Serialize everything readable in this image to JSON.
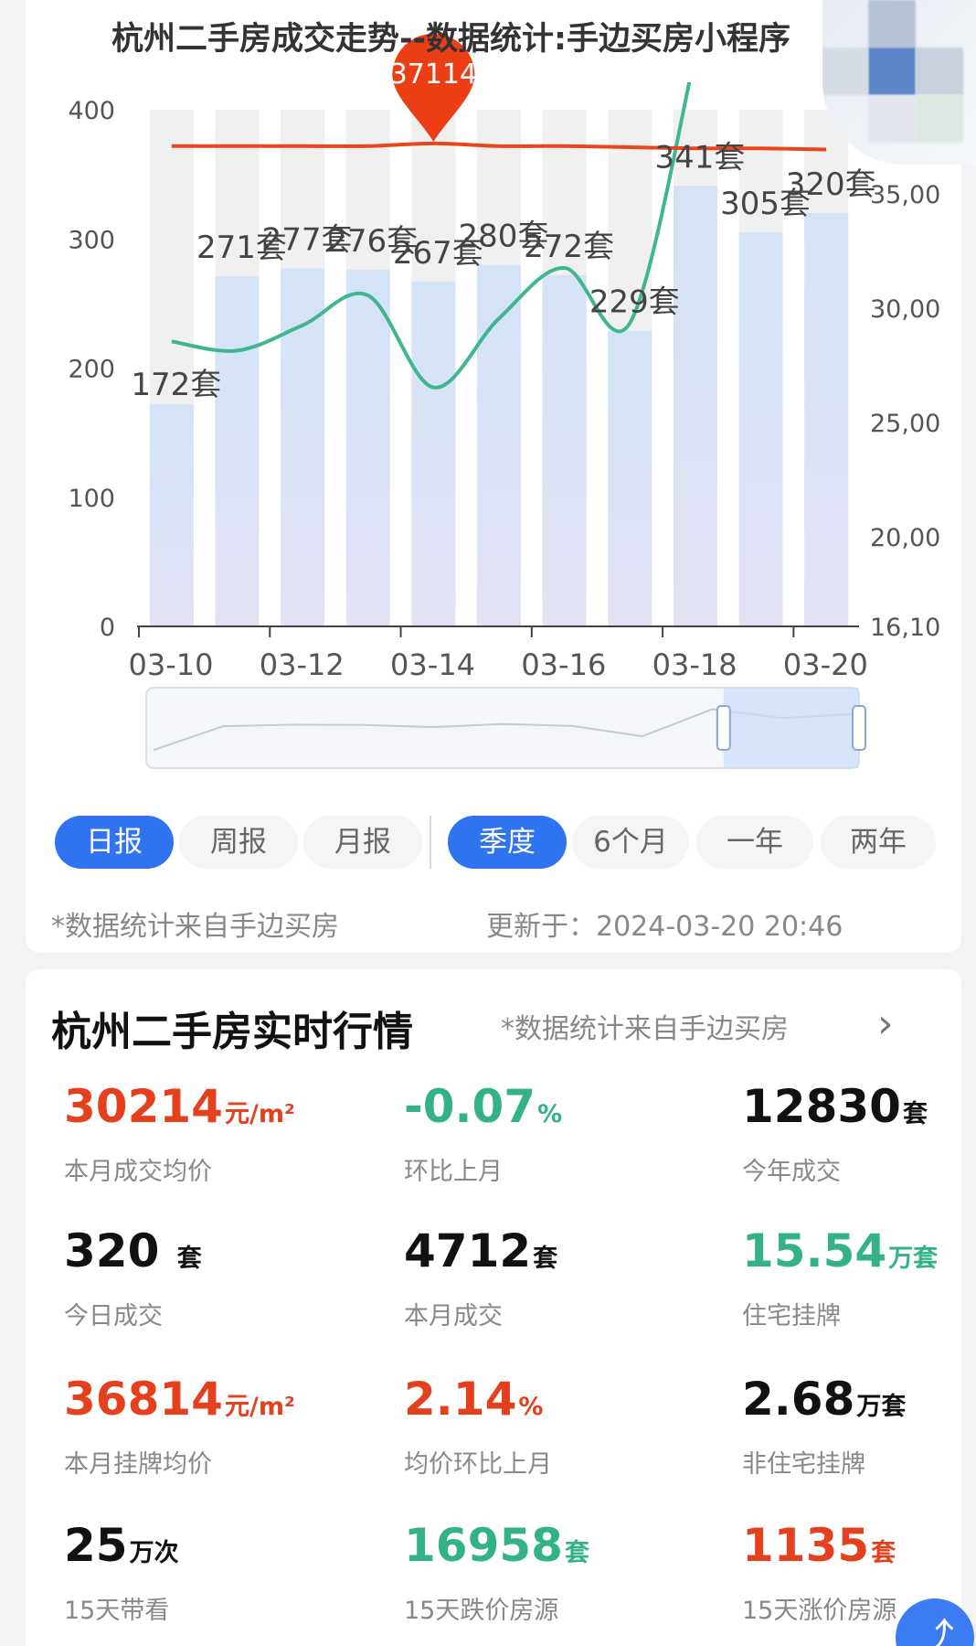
{
  "chart_title": "杭州二手房成交走势--数据统计:手边买房小程序",
  "chart_data": {
    "type": "bar+line",
    "title": "杭州二手房成交走势--数据统计:手边买房小程序",
    "categories": [
      "03-10",
      "03-11",
      "03-12",
      "03-13",
      "03-14",
      "03-15",
      "03-16",
      "03-17",
      "03-18",
      "03-19",
      "03-20"
    ],
    "x_tick_labels": [
      "03-10",
      "03-12",
      "03-14",
      "03-16",
      "03-18",
      "03-20"
    ],
    "bars": {
      "values": [
        172,
        271,
        277,
        276,
        267,
        280,
        272,
        229,
        341,
        305,
        320
      ],
      "labels": [
        "172套",
        "271套",
        "277套",
        "276套",
        "267套",
        "280套",
        "272套",
        "229套",
        "341套",
        "305套",
        "320套"
      ]
    },
    "y_left": {
      "ticks": [
        "400",
        "300",
        "200",
        "100",
        "0"
      ],
      "ylim": [
        0,
        400
      ]
    },
    "y_right": {
      "ticks": [
        "35,00",
        "30,00",
        "25,00",
        "20,00",
        "16,10"
      ],
      "ylim": [
        16100,
        35000
      ]
    },
    "green_line": {
      "values": [
        28500,
        28100,
        29200,
        30500,
        26500,
        29500,
        31700,
        29300,
        41000,
        41000,
        41000
      ]
    },
    "red_line": {
      "values": [
        37000,
        37000,
        37000,
        37000,
        37114,
        37000,
        37000,
        36950,
        36900,
        36900,
        36850
      ]
    },
    "marker": {
      "label": "37114",
      "category": "03-14"
    },
    "zoom_window": {
      "start_fraction": 0.81,
      "end_fraction": 1.0
    },
    "colors": {
      "bar": "#d7e3f5",
      "bar_bg": "#f0f0f0",
      "green": "#3fb68e",
      "red": "#e8471b",
      "marker": "#ec3e14",
      "text": "#444444"
    }
  },
  "tabs": [
    {
      "label": "日报",
      "active": true
    },
    {
      "label": "周报",
      "active": false
    },
    {
      "label": "月报",
      "active": false
    },
    {
      "label": "季度",
      "active": true
    },
    {
      "label": "6个月",
      "active": false
    },
    {
      "label": "一年",
      "active": false
    },
    {
      "label": "两年",
      "active": false
    }
  ],
  "footnote_source": "*数据统计来自手边买房",
  "footnote_updated": "更新于：2024-03-20 20:46",
  "market": {
    "title": "杭州二手房实时行情",
    "subtitle": "*数据统计来自手边买房",
    "arrow": "›",
    "metrics": [
      {
        "value": "30214",
        "unit": "元/m²",
        "label": "本月成交均价",
        "color": "red"
      },
      {
        "value": "-0.07",
        "unit": "%",
        "label": "环比上月",
        "color": "green"
      },
      {
        "value": "12830",
        "unit": "套",
        "label": "今年成交",
        "color": "black"
      },
      {
        "value": "320 ",
        "unit": "套",
        "label": "今日成交",
        "color": "black"
      },
      {
        "value": "4712",
        "unit": "套",
        "label": "本月成交",
        "color": "black"
      },
      {
        "value": "15.54",
        "unit": "万套",
        "label": "住宅挂牌",
        "color": "green"
      },
      {
        "value": "36814",
        "unit": "元/m²",
        "label": "本月挂牌均价",
        "color": "red"
      },
      {
        "value": "2.14",
        "unit": "%",
        "label": "均价环比上月",
        "color": "red"
      },
      {
        "value": "2.68",
        "unit": "万套",
        "label": "非住宅挂牌",
        "color": "black"
      },
      {
        "value": "25",
        "unit": "万次",
        "label": "15天带看",
        "color": "black"
      },
      {
        "value": "16958",
        "unit": "套",
        "label": "15天跌价房源",
        "color": "green"
      },
      {
        "value": "1135",
        "unit": "套",
        "label": "15天涨价房源",
        "color": "red"
      }
    ]
  },
  "fab_icon": "share-icon"
}
